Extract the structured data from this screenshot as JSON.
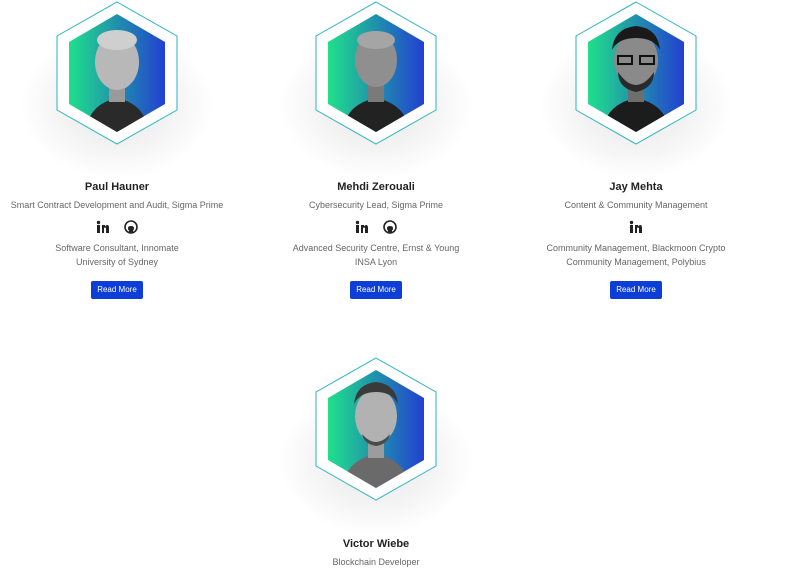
{
  "colors": {
    "accent_green": "#1fe08a",
    "accent_blue": "#2240d0",
    "button": "#0d3fd8"
  },
  "team": [
    {
      "name": "Paul Hauner",
      "role": "Smart Contract Development and Audit, Sigma Prime",
      "socials": [
        "linkedin-icon",
        "github-icon"
      ],
      "bio": [
        "Software Consultant, Innomate",
        "University of Sydney"
      ],
      "button": "Read More"
    },
    {
      "name": "Mehdi Zerouali",
      "role": "Cybersecurity Lead, Sigma Prime",
      "socials": [
        "linkedin-icon",
        "github-icon"
      ],
      "bio": [
        "Advanced Security Centre, Ernst & Young",
        "INSA Lyon"
      ],
      "button": "Read More"
    },
    {
      "name": "Jay Mehta",
      "role": "Content & Community Management",
      "socials": [
        "linkedin-icon"
      ],
      "bio": [
        "Community Management, Blackmoon Crypto",
        "Community Management, Polybius"
      ],
      "button": "Read More"
    },
    {
      "name": "Victor Wiebe",
      "role": "Blockchain Developer"
    }
  ]
}
